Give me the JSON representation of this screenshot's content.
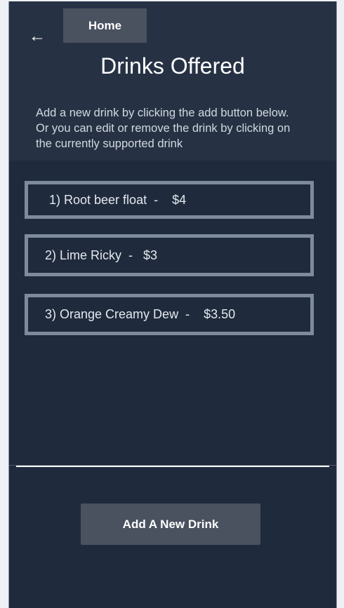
{
  "header": {
    "home_label": "Home",
    "title": "Drinks Offered",
    "description": "Add a new drink by clicking the add button below. Or you can edit or remove the drink by  clicking on the currently supported drink"
  },
  "drinks": [
    {
      "label": "1) Root beer float  -    $4"
    },
    {
      "label": "2) Lime Ricky  -   $3"
    },
    {
      "label": "3) Orange Creamy Dew  -    $3.50"
    }
  ],
  "footer": {
    "add_label": "Add A New Drink"
  }
}
